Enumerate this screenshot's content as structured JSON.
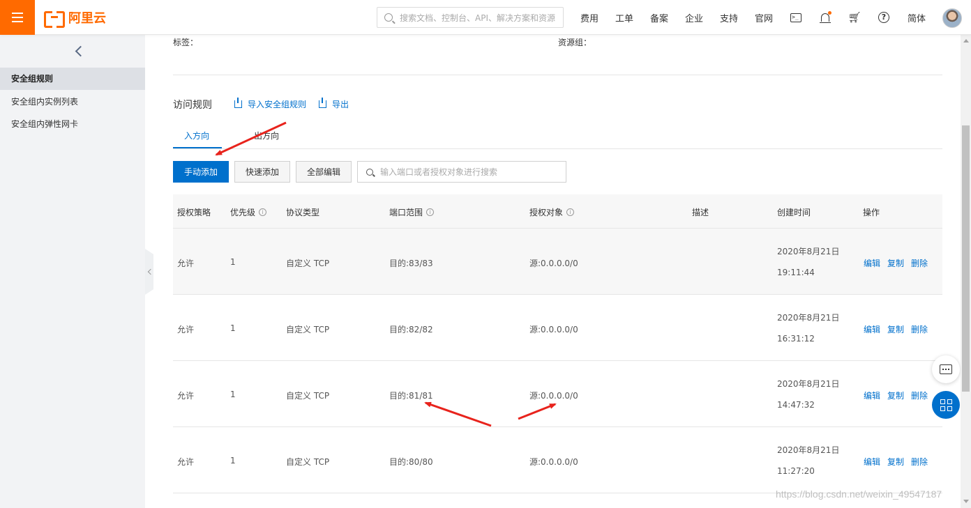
{
  "brand": {
    "name": "阿里云",
    "color": "#ff6a00"
  },
  "topbar": {
    "search_placeholder": "搜索文档、控制台、API、解决方案和资源",
    "nav": [
      "费用",
      "工单",
      "备案",
      "企业",
      "支持",
      "官网"
    ],
    "icons": [
      "terminal-icon",
      "bell-icon",
      "cart-icon",
      "help-icon"
    ],
    "lang": "简体"
  },
  "sidebar": {
    "items": [
      {
        "label": "安全组规则",
        "active": true
      },
      {
        "label": "安全组内实例列表",
        "active": false
      },
      {
        "label": "安全组内弹性网卡",
        "active": false
      }
    ]
  },
  "info": {
    "tag_label": "标签：",
    "rg_label": "资源组："
  },
  "rules": {
    "title": "访问规则",
    "import_label": "导入安全组规则",
    "export_label": "导出",
    "tabs": [
      "入方向",
      "出方向"
    ],
    "buttons": {
      "manual_add": "手动添加",
      "quick_add": "快速添加",
      "edit_all": "全部编辑"
    },
    "filter_placeholder": "输入端口或者授权对象进行搜索",
    "columns": [
      "授权策略",
      "优先级",
      "协议类型",
      "端口范围",
      "授权对象",
      "描述",
      "创建时间",
      "操作"
    ],
    "rows": [
      {
        "policy": "允许",
        "priority": "1",
        "protocol": "自定义 TCP",
        "port": "目的:83/83",
        "source": "源:0.0.0.0/0",
        "desc": "",
        "date": "2020年8月21日",
        "time": "19:11:44"
      },
      {
        "policy": "允许",
        "priority": "1",
        "protocol": "自定义 TCP",
        "port": "目的:82/82",
        "source": "源:0.0.0.0/0",
        "desc": "",
        "date": "2020年8月21日",
        "time": "16:31:12"
      },
      {
        "policy": "允许",
        "priority": "1",
        "protocol": "自定义 TCP",
        "port": "目的:81/81",
        "source": "源:0.0.0.0/0",
        "desc": "",
        "date": "2020年8月21日",
        "time": "14:47:32"
      },
      {
        "policy": "允许",
        "priority": "1",
        "protocol": "自定义 TCP",
        "port": "目的:80/80",
        "source": "源:0.0.0.0/0",
        "desc": "",
        "date": "2020年8月21日",
        "time": "11:27:20"
      }
    ],
    "ops": {
      "edit": "编辑",
      "copy": "复制",
      "delete": "删除"
    }
  },
  "watermark": "https://blog.csdn.net/weixin_49547187",
  "colors": {
    "primary": "#0070cc",
    "annotation": "#e8231c"
  }
}
